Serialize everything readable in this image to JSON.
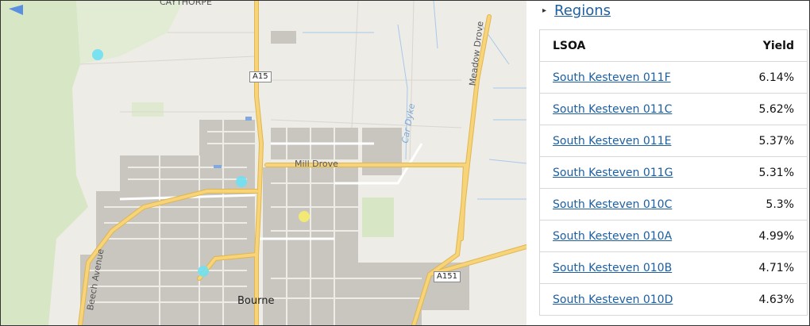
{
  "map": {
    "labels": {
      "caythorpe": "CAYTHORPE",
      "mill_drove": "Mill Drove",
      "meadow_drove": "Meadow Drove",
      "car_dyke": "Car Dyke",
      "beech_avenue": "Beech Avenue",
      "bourne": "Bourne",
      "a15": "A15",
      "a151": "A151"
    },
    "colors": {
      "background": "#eeece6",
      "road_major": "#f7d47a",
      "road_minor": "#ffffff",
      "water": "#a7c8ec",
      "green": "#d7e6c4",
      "building": "#c9c5bf",
      "marker_blue": "#6ee0f2",
      "marker_yellow": "#f5ec6a"
    }
  },
  "sidebar": {
    "regions_link": "Regions",
    "table": {
      "headers": {
        "lsoa": "LSOA",
        "yield": "Yield"
      },
      "rows": [
        {
          "name": "South Kesteven 011F",
          "yield": "6.14%"
        },
        {
          "name": "South Kesteven 011C",
          "yield": "5.62%"
        },
        {
          "name": "South Kesteven 011E",
          "yield": "5.37%"
        },
        {
          "name": "South Kesteven 011G",
          "yield": "5.31%"
        },
        {
          "name": "South Kesteven 010C",
          "yield": "5.3%"
        },
        {
          "name": "South Kesteven 010A",
          "yield": "4.99%"
        },
        {
          "name": "South Kesteven 010B",
          "yield": "4.71%"
        },
        {
          "name": "South Kesteven 010D",
          "yield": "4.63%"
        }
      ]
    }
  }
}
